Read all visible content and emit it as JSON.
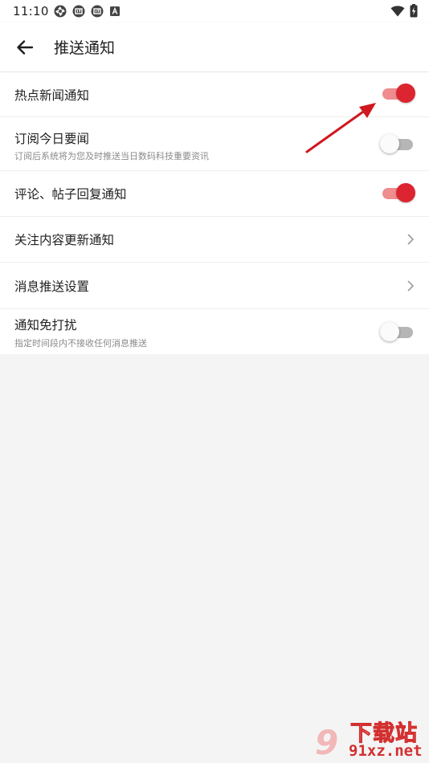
{
  "status_bar": {
    "time": "11:10"
  },
  "header": {
    "title": "推送通知",
    "back_icon": "arrow-left-icon"
  },
  "settings": [
    {
      "label": "热点新闻通知",
      "subtitle": "",
      "control": "toggle",
      "on": true
    },
    {
      "label": "订阅今日要闻",
      "subtitle": "订阅后系统将为您及时推送当日数码科技重要资讯",
      "control": "toggle",
      "on": false
    },
    {
      "label": "评论、帖子回复通知",
      "subtitle": "",
      "control": "toggle",
      "on": true
    },
    {
      "label": "关注内容更新通知",
      "subtitle": "",
      "control": "chevron"
    },
    {
      "label": "消息推送设置",
      "subtitle": "",
      "control": "chevron"
    },
    {
      "label": "通知免打扰",
      "subtitle": "指定时间段内不接收任何消息推送",
      "control": "toggle",
      "on": false
    }
  ],
  "watermark": {
    "title": "下载站",
    "url": "91xz.net",
    "logo": "9"
  },
  "colors": {
    "accent": "#dc2530",
    "accent_track": "#ee8c8f",
    "background": "#f4f4f4",
    "annotation_arrow": "#d0181f"
  }
}
